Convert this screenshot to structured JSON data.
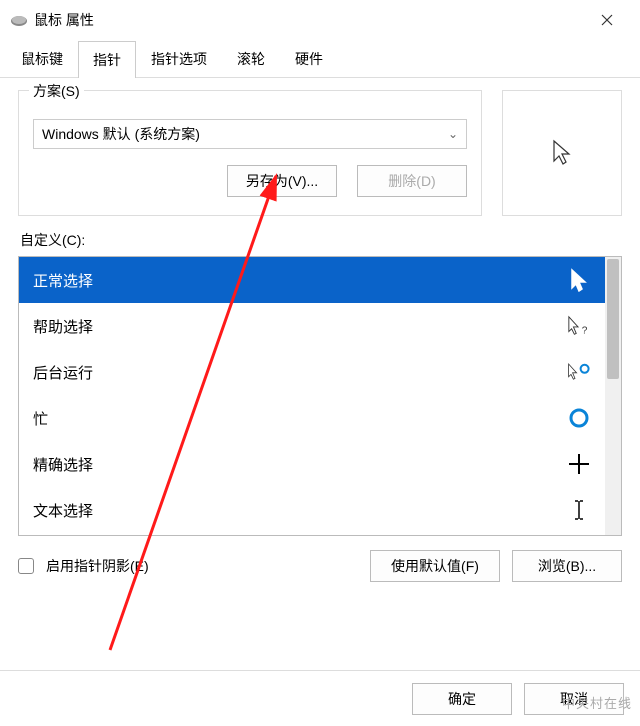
{
  "window": {
    "title": "鼠标 属性"
  },
  "tabs": [
    "鼠标键",
    "指针",
    "指针选项",
    "滚轮",
    "硬件"
  ],
  "active_tab": 1,
  "scheme": {
    "label": "方案(S)",
    "value": "Windows 默认 (系统方案)",
    "save_as": "另存为(V)...",
    "delete": "删除(D)"
  },
  "customize_label": "自定义(C):",
  "cursor_list": [
    {
      "name": "正常选择",
      "icon": "arrow",
      "selected": true
    },
    {
      "name": "帮助选择",
      "icon": "arrow-help",
      "selected": false
    },
    {
      "name": "后台运行",
      "icon": "arrow-ring",
      "selected": false
    },
    {
      "name": "忙",
      "icon": "ring",
      "selected": false
    },
    {
      "name": "精确选择",
      "icon": "cross",
      "selected": false
    },
    {
      "name": "文本选择",
      "icon": "ibeam",
      "selected": false
    }
  ],
  "shadow": {
    "label": "启用指针阴影(E)",
    "checked": false
  },
  "defaults_btn": "使用默认值(F)",
  "browse_btn": "浏览(B)...",
  "footer": {
    "ok": "确定",
    "cancel": "取消"
  },
  "watermark": "中关村在线"
}
